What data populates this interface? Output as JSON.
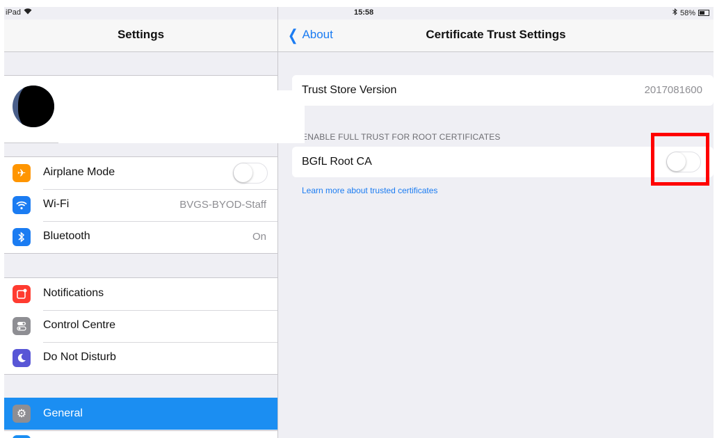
{
  "status_bar": {
    "device": "iPad",
    "time": "15:58",
    "battery": "58%"
  },
  "left_pane": {
    "title": "Settings",
    "group1": [
      {
        "icon": "airplane-icon",
        "label": "Airplane Mode",
        "toggle": "off",
        "color": "#ff9500"
      },
      {
        "icon": "wifi-icon",
        "label": "Wi-Fi",
        "value": "BVGS-BYOD-Staff",
        "color": "#1b7cf2"
      },
      {
        "icon": "bluetooth-icon",
        "label": "Bluetooth",
        "value": "On",
        "color": "#1b7cf2"
      }
    ],
    "group2": [
      {
        "icon": "notifications-icon",
        "label": "Notifications",
        "color": "#ff3b30"
      },
      {
        "icon": "control-centre-icon",
        "label": "Control Centre",
        "color": "#8e8e93"
      },
      {
        "icon": "moon-icon",
        "label": "Do Not Disturb",
        "color": "#5856d6"
      }
    ],
    "selected": {
      "icon": "gear-icon",
      "label": "General",
      "color": "#1b8ef2"
    }
  },
  "right_pane": {
    "back_label": "About",
    "title": "Certificate Trust Settings",
    "trust_store": {
      "label": "Trust Store Version",
      "value": "2017081600"
    },
    "section_header": "ENABLE FULL TRUST FOR ROOT CERTIFICATES",
    "certificate": {
      "label": "BGfL Root CA",
      "toggle": "off"
    },
    "learn_more": "Learn more about trusted certificates",
    "highlight_color": "#ff0000"
  }
}
